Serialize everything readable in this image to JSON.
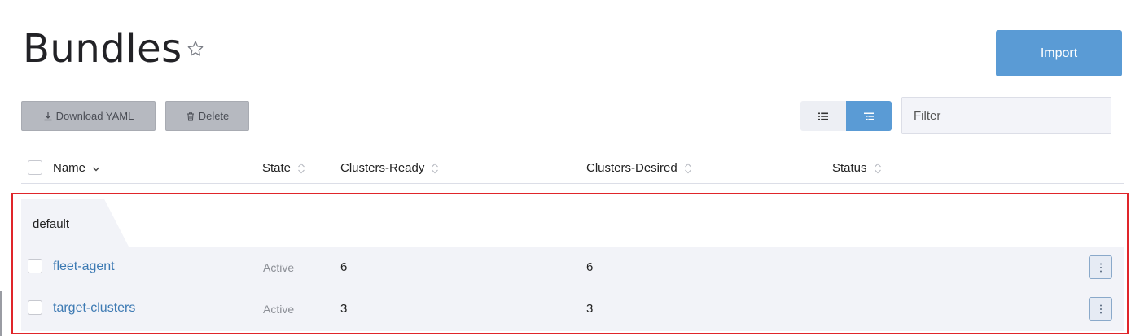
{
  "header": {
    "title": "Bundles",
    "import_label": "Import"
  },
  "toolbar": {
    "download_label": "Download YAML",
    "delete_label": "Delete",
    "filter_placeholder": "Filter"
  },
  "table": {
    "columns": [
      "Name",
      "State",
      "Clusters-Ready",
      "Clusters-Desired",
      "Status"
    ],
    "group": "default",
    "rows": [
      {
        "name": "fleet-agent",
        "state": "Active",
        "clusters_ready": "6",
        "clusters_desired": "6"
      },
      {
        "name": "target-clusters",
        "state": "Active",
        "clusters_ready": "3",
        "clusters_desired": "3"
      }
    ]
  },
  "colors": {
    "accent": "#5a9bd5",
    "link": "#3d7ab3",
    "highlight": "#e0252a"
  }
}
